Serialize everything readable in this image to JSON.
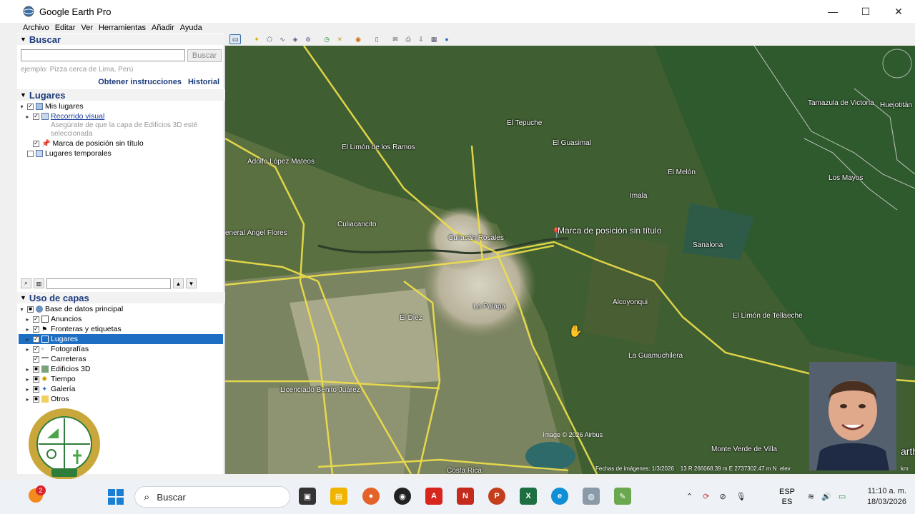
{
  "window": {
    "title": "Google Earth Pro",
    "minimize": "—",
    "maximize": "☐",
    "close": "✕"
  },
  "menu": [
    "Archivo",
    "Editar",
    "Ver",
    "Herramientas",
    "Añadir",
    "Ayuda"
  ],
  "search": {
    "header": "Buscar",
    "button": "Buscar",
    "placeholder": "",
    "hint": "ejemplo: Pizza cerca de Lima, Perú",
    "directions": "Obtener instrucciones",
    "history": "Historial"
  },
  "places": {
    "header": "Lugares",
    "items": [
      {
        "label": "Mis lugares"
      },
      {
        "label": "Recorrido visual"
      },
      {
        "label": "Asegúrate de que la capa de Edificios 3D esté seleccionada"
      },
      {
        "label": "Marca de posición sin título"
      },
      {
        "label": "Lugares temporales"
      }
    ]
  },
  "layers": {
    "header": "Uso de capas",
    "items": [
      {
        "label": "Base de datos principal"
      },
      {
        "label": "Anuncios"
      },
      {
        "label": "Fronteras y etiquetas"
      },
      {
        "label": "Lugares"
      },
      {
        "label": "Fotografías"
      },
      {
        "label": "Carreteras"
      },
      {
        "label": "Edificios 3D"
      },
      {
        "label": "Tiempo"
      },
      {
        "label": "Galería"
      },
      {
        "label": "Otros"
      }
    ]
  },
  "map": {
    "labels": [
      "El Tepuche",
      "El Limón de los Ramos",
      "El Guasimal",
      "Adolfo López Mateos",
      "El Melón",
      "Imala",
      "Tamazula de Victoria",
      "Huejotitán",
      "Los Mayos",
      "Culiacancito",
      "Culiacán Rosales",
      "Marca de posición sin título",
      "Sanalona",
      "eneral Ángel Flores",
      "Alcoyonqui",
      "El Limón de Tellaeche",
      "El Diez",
      "La Palapa",
      "La Guamuchilera",
      "Licenciado Benito Juárez",
      "Monte Verde de Villa",
      "Costa Rica",
      "Image © 2026 Airbus",
      "arth"
    ],
    "credits": "Fechas de imágenes: 1/3/2026",
    "coords": "13 R 266068.39 m E 2737302.47 m N",
    "elev": "elev",
    "scale": "km"
  },
  "taskbar": {
    "search": "Buscar",
    "notif_count": "2",
    "lang1": "ESP",
    "lang2": "ES",
    "time": "11:10 a. m.",
    "date": "18/03/2026"
  }
}
